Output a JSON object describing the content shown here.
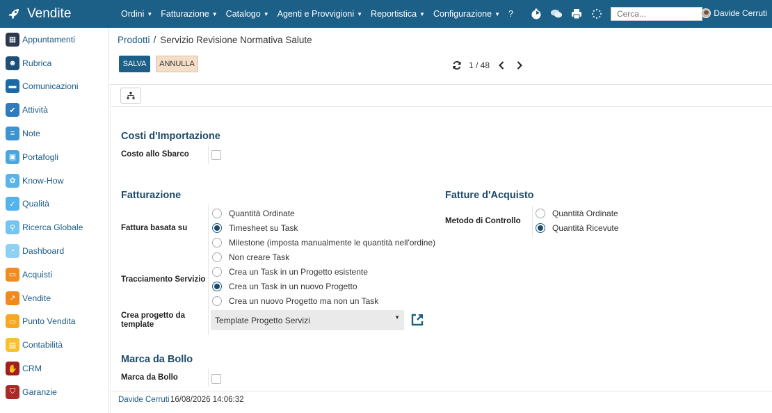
{
  "app": {
    "title": "Vendite"
  },
  "menu": [
    {
      "label": "Ordini",
      "caret": true
    },
    {
      "label": "Fatturazione",
      "caret": true
    },
    {
      "label": "Catalogo",
      "caret": true
    },
    {
      "label": "Agenti e Provvigioni",
      "caret": true
    },
    {
      "label": "Reportistica",
      "caret": true
    },
    {
      "label": "Configurazione",
      "caret": true
    },
    {
      "label": "?",
      "caret": false
    }
  ],
  "search": {
    "placeholder": "Cerca..."
  },
  "user": {
    "name": "Davide Cerruti"
  },
  "sidebar": {
    "items": [
      {
        "label": "Appuntamenti",
        "icon": "calendar-icon",
        "color": "#2b3a4e"
      },
      {
        "label": "Rubrica",
        "icon": "contacts-icon",
        "color": "#1d4f77"
      },
      {
        "label": "Comunicazioni",
        "icon": "chat-icon",
        "color": "#1a6aa6"
      },
      {
        "label": "Attività",
        "icon": "checkbox-icon",
        "color": "#2f7bbd"
      },
      {
        "label": "Note",
        "icon": "notes-icon",
        "color": "#3d94d1"
      },
      {
        "label": "Portafogli",
        "icon": "lock-icon",
        "color": "#4aa6df"
      },
      {
        "label": "Know-How",
        "icon": "brain-icon",
        "color": "#59b4e7"
      },
      {
        "label": "Qualità",
        "icon": "quality-icon",
        "color": "#53b3ea"
      },
      {
        "label": "Ricerca Globale",
        "icon": "search-icon",
        "color": "#74c4ef"
      },
      {
        "label": "Dashboard",
        "icon": "dashboard-icon",
        "color": "#8fd1f2"
      },
      {
        "label": "Acquisti",
        "icon": "card-icon",
        "color": "#f08c21"
      },
      {
        "label": "Vendite",
        "icon": "chart-icon",
        "color": "#f2891b"
      },
      {
        "label": "Punto Vendita",
        "icon": "monitor-icon",
        "color": "#f6a821"
      },
      {
        "label": "Contabilità",
        "icon": "document-icon",
        "color": "#f7c22e"
      },
      {
        "label": "CRM",
        "icon": "handshake-icon",
        "color": "#a0201d"
      },
      {
        "label": "Garanzie",
        "icon": "shield-icon",
        "color": "#a92a24"
      }
    ]
  },
  "breadcrumb": {
    "parent": "Prodotti",
    "separator": "/",
    "current": "Servizio Revisione Normativa Salute"
  },
  "buttons": {
    "save": "SALVA",
    "discard": "ANNULLA"
  },
  "pager": {
    "value": "1 / 48"
  },
  "form": {
    "import_costs": {
      "title": "Costi d'Importazione",
      "landed_cost_label": "Costo allo Sbarco",
      "landed_cost_checked": false
    },
    "invoicing": {
      "title": "Fatturazione",
      "invoice_policy_label": "Fattura basata su",
      "invoice_policy_options": [
        {
          "label": "Quantità Ordinate",
          "checked": false
        },
        {
          "label": "Timesheet su Task",
          "checked": true
        },
        {
          "label": "Milestone (imposta manualmente le quantità nell'ordine)",
          "checked": false
        }
      ],
      "service_tracking_label": "Tracciamento Servizio",
      "service_tracking_options": [
        {
          "label": "Non creare Task",
          "checked": false
        },
        {
          "label": "Crea un Task in un Progetto esistente",
          "checked": false
        },
        {
          "label": "Crea un Task in un nuovo Progetto",
          "checked": true
        },
        {
          "label": "Crea un nuovo Progetto ma non un Task",
          "checked": false
        }
      ],
      "project_template_label": "Crea progetto da template",
      "project_template_value": "Template Progetto Servizi"
    },
    "vendor_bills": {
      "title": "Fatture d'Acquisto",
      "control_policy_label": "Metodo di Controllo",
      "control_policy_options": [
        {
          "label": "Quantità Ordinate",
          "checked": false
        },
        {
          "label": "Quantità Ricevute",
          "checked": true
        }
      ]
    },
    "stamp_duty": {
      "title": "Marca da Bollo",
      "label": "Marca da Bollo",
      "checked": false
    }
  },
  "chatter": {
    "user": "Davide Cerruti",
    "date": "16/08/2026 14:06:32"
  },
  "colors": {
    "topbar": "#1c5f87",
    "accent": "#1d5b86",
    "discard_bg": "#f5dec8"
  }
}
